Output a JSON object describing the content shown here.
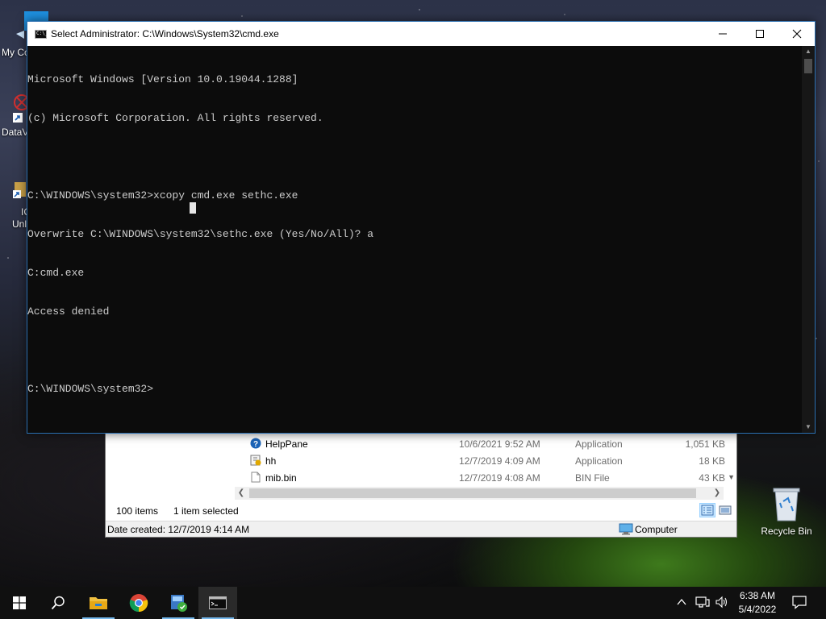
{
  "desktop": {
    "icons": [
      {
        "label": "My Co",
        "icon": "computer-icon"
      },
      {
        "label": "DataV",
        "icon": "datav-icon"
      },
      {
        "label": "IC",
        "icon": "shortcut-icon"
      },
      {
        "label": "Unl",
        "icon": "shortcut-icon"
      }
    ],
    "recycle_bin": {
      "label": "Recycle Bin",
      "icon": "recycle-bin-icon"
    }
  },
  "cmd_window": {
    "title": "Select Administrator: C:\\Windows\\System32\\cmd.exe",
    "lines": [
      "Microsoft Windows [Version 10.0.19044.1288]",
      "(c) Microsoft Corporation. All rights reserved.",
      "",
      "C:\\WINDOWS\\system32>xcopy cmd.exe sethc.exe",
      "Overwrite C:\\WINDOWS\\system32\\sethc.exe (Yes/No/All)? a",
      "C:cmd.exe",
      "Access denied",
      "",
      "C:\\WINDOWS\\system32>"
    ],
    "buttons": {
      "minimize": "minimize-icon",
      "maximize": "maximize-icon",
      "close": "close-icon"
    }
  },
  "explorer": {
    "files": [
      {
        "name": "HelpPane",
        "date": "10/6/2021 9:52 AM",
        "type": "Application",
        "size": "1,051 KB",
        "icon": "help-icon"
      },
      {
        "name": "hh",
        "date": "12/7/2019 4:09 AM",
        "type": "Application",
        "size": "18 KB",
        "icon": "help-file-icon"
      },
      {
        "name": "mib.bin",
        "date": "12/7/2019 4:08 AM",
        "type": "BIN File",
        "size": "43 KB",
        "icon": "file-icon"
      }
    ],
    "status": {
      "item_count": "100 items",
      "selected": "1 item selected"
    },
    "details": {
      "date_created": "Date created: 12/7/2019 4:14 AM",
      "location": "Computer"
    }
  },
  "taskbar": {
    "apps": [
      {
        "name": "start",
        "icon": "windows-logo-icon"
      },
      {
        "name": "search",
        "icon": "search-icon"
      },
      {
        "name": "file-explorer",
        "icon": "folder-icon"
      },
      {
        "name": "chrome",
        "icon": "chrome-icon"
      },
      {
        "name": "app",
        "icon": "app-icon"
      },
      {
        "name": "cmd",
        "icon": "cmd-icon"
      }
    ],
    "tray": {
      "time": "6:38 AM",
      "date": "5/4/2022"
    }
  },
  "colors": {
    "accent": "#76b9ed",
    "cmd_bg": "#0c0c0c",
    "cmd_text": "#cccccc"
  }
}
